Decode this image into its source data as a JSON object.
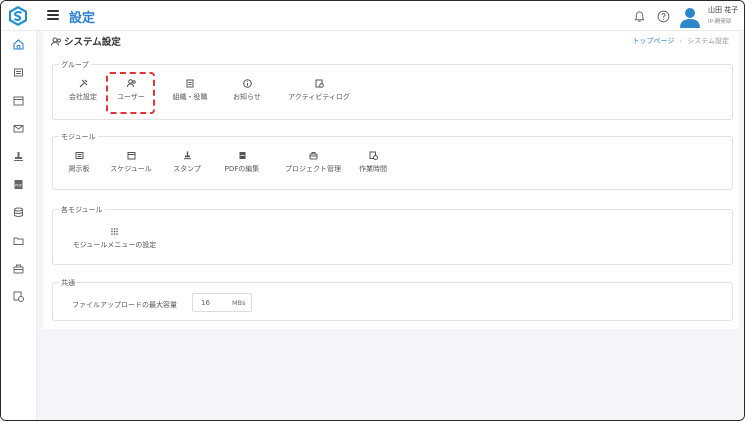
{
  "header": {
    "title": "設定",
    "user_name": "山田 花子",
    "user_dept": "IP-開発部"
  },
  "page": {
    "title": "システム設定",
    "breadcrumb": {
      "home": "トップページ",
      "current": "システム設定"
    }
  },
  "sections": {
    "group": {
      "label": "グループ",
      "items": [
        {
          "label": "会社設定",
          "icon": "tools-icon"
        },
        {
          "label": "ユーザー",
          "icon": "users-icon"
        },
        {
          "label": "組織・役職",
          "icon": "org-icon"
        },
        {
          "label": "お知らせ",
          "icon": "info-icon"
        },
        {
          "label": "アクティビティログ",
          "icon": "log-icon"
        }
      ]
    },
    "module": {
      "label": "モジュール",
      "items": [
        {
          "label": "掲示板",
          "icon": "board-icon"
        },
        {
          "label": "スケジュール",
          "icon": "calendar-icon"
        },
        {
          "label": "スタンプ",
          "icon": "stamp-icon"
        },
        {
          "label": "PDFの編集",
          "icon": "pdf-icon"
        },
        {
          "label": "プロジェクト管理",
          "icon": "project-icon"
        },
        {
          "label": "作業時間",
          "icon": "worktime-icon"
        }
      ]
    },
    "each_module": {
      "label": "各モジュール",
      "items": [
        {
          "label": "モジュールメニューの設定",
          "icon": "grid-icon"
        }
      ]
    },
    "common": {
      "label": "共通",
      "max_upload_label": "ファイルアップロードの最大容量",
      "max_upload_value": "16",
      "max_upload_unit": "MBs"
    }
  },
  "colors": {
    "accent": "#2a7fd6",
    "highlight": "#e23333",
    "background": "#f3f5f8"
  }
}
